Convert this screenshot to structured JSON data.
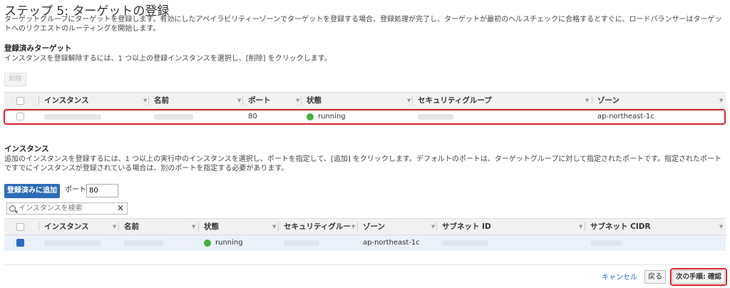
{
  "page": {
    "title": "ステップ 5: ターゲットの登録",
    "description": "ターゲットグループにターゲットを登録します。有効にしたアベイラビリティーゾーンでターゲットを登録する場合、登録処理が完了し、ターゲットが最初のヘルスチェックに合格するとすぐに、ロードバランサーはターゲットへのリクエストのルーティングを開始します。"
  },
  "registered": {
    "title": "登録済みターゲット",
    "description": "インスタンスを登録解除するには、1 つ以上の登録インスタンスを選択し、[削除] をクリックします。",
    "remove_label": "削除",
    "columns": [
      "インスタンス",
      "名前",
      "ポート",
      "状態",
      "セキュリティグループ",
      "ゾーン"
    ],
    "rows": [
      {
        "port": "80",
        "status": "running",
        "zone": "ap-northeast-1c"
      }
    ]
  },
  "instances": {
    "title": "インスタンス",
    "description": "追加のインスタンスを登録するには、1 つ以上の実行中のインスタンスを選択し、ポートを指定して、[追加] をクリックします。デフォルトのポートは、ターゲットグループに対して指定されたポートです。指定されたポートですでにインスタンスが登録されている場合は、別のポートを指定する必要があります。",
    "add_label": "登録済みに追加",
    "port_label": "ポート",
    "port_value": "80",
    "search_placeholder": "インスタンスを検索",
    "columns": [
      "インスタンス",
      "名前",
      "状態",
      "セキュリティグルー",
      "ゾーン",
      "サブネット ID",
      "サブネット CIDR"
    ],
    "rows": [
      {
        "status": "running",
        "zone": "ap-northeast-1c",
        "selected": true
      }
    ]
  },
  "footer": {
    "cancel_label": "キャンセル",
    "back_label": "戻る",
    "next_label": "次の手順: 確認"
  },
  "colors": {
    "primary": "#2e6db5",
    "running": "#44b23a",
    "highlight": "#d9242b",
    "link": "#2c6bc9"
  },
  "icons": [
    "sort-arrow-icon",
    "status-running-icon",
    "search-icon",
    "clear-icon"
  ]
}
